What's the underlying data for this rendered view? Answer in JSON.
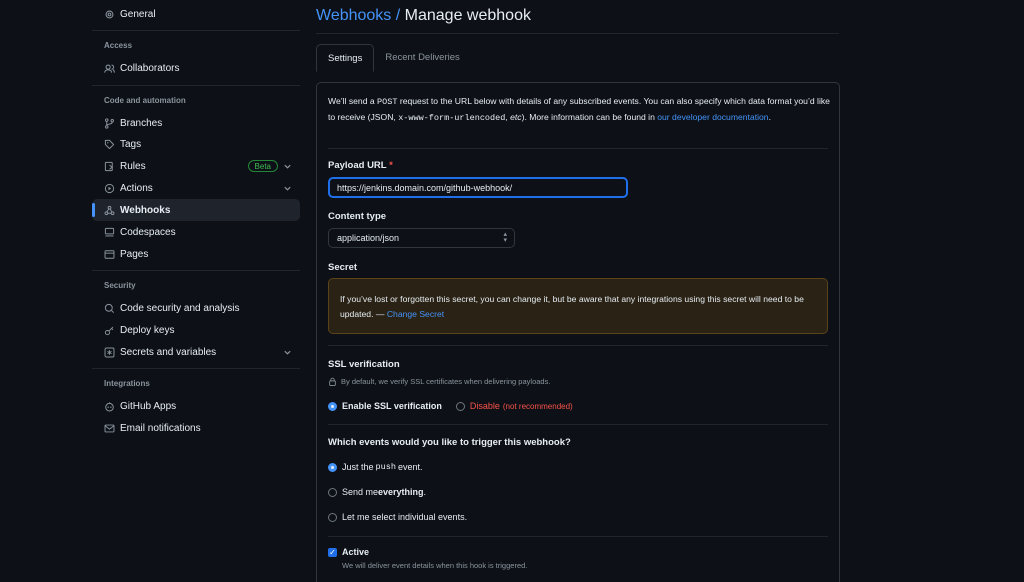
{
  "sidebar": {
    "general": "General",
    "sections": {
      "access": "Access",
      "code_automation": "Code and automation",
      "security": "Security",
      "integrations": "Integrations"
    },
    "items": {
      "collaborators": "Collaborators",
      "branches": "Branches",
      "tags": "Tags",
      "rules": "Rules",
      "rules_badge": "Beta",
      "actions": "Actions",
      "webhooks": "Webhooks",
      "codespaces": "Codespaces",
      "pages": "Pages",
      "code_security": "Code security and analysis",
      "deploy_keys": "Deploy keys",
      "secrets_variables": "Secrets and variables",
      "github_apps": "GitHub Apps",
      "email_notifications": "Email notifications"
    },
    "active_item": "webhooks"
  },
  "header": {
    "breadcrumb": "Webhooks",
    "separator": " / ",
    "title": "Manage webhook"
  },
  "tabs": {
    "settings": "Settings",
    "recent_deliveries": "Recent Deliveries"
  },
  "intro": {
    "part1": "We’ll send a ",
    "post": "POST",
    "part2": " request to the URL below with details of any subscribed events. You can also specify which data format you’d like to receive (JSON, ",
    "form": "x-www-form-urlencoded",
    "part3": ", ",
    "etc": "etc",
    "part4": "). More information can be found in ",
    "link": "our developer documentation",
    "part5": "."
  },
  "payload": {
    "label": "Payload URL",
    "required": "*",
    "value": "https://jenkins.domain.com/github-webhook/"
  },
  "content_type": {
    "label": "Content type",
    "value": "application/json"
  },
  "secret": {
    "label": "Secret",
    "warning": "If you’ve lost or forgotten this secret, you can change it, but be aware that any integrations using this secret will need to be updated. — ",
    "link": "Change Secret"
  },
  "ssl": {
    "label": "SSL verification",
    "note": "By default, we verify SSL certificates when delivering payloads.",
    "enable": "Enable SSL verification",
    "disable": "Disable",
    "not_recommended": "(not recommended)",
    "selected": "enable"
  },
  "events": {
    "question": "Which events would you like to trigger this webhook?",
    "just_push_a": "Just the ",
    "push": "push",
    "just_push_b": " event.",
    "everything_a": "Send me ",
    "everything_b": "everything",
    "everything_c": ".",
    "individual": "Let me select individual events.",
    "selected": "push"
  },
  "active": {
    "label": "Active",
    "checked": true,
    "note": "We will deliver event details when this hook is triggered."
  },
  "colors": {
    "background": "#0d1117",
    "accent": "#4493f8",
    "danger": "#f85149",
    "success": "#3fb950"
  }
}
